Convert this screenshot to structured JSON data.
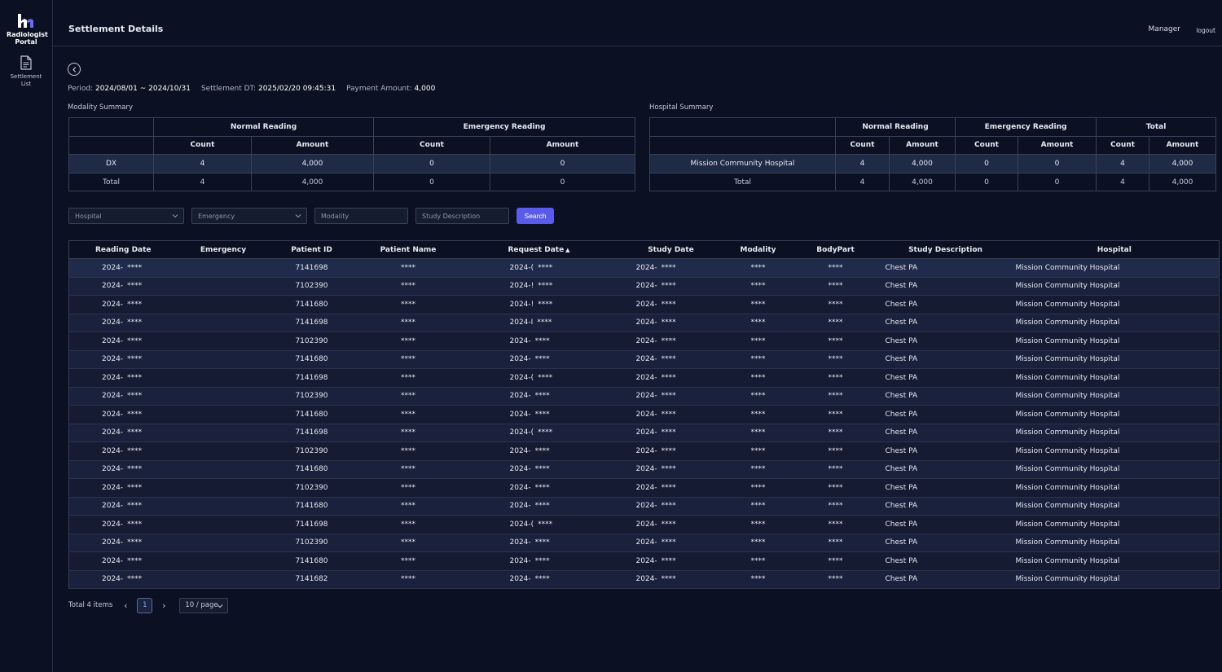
{
  "app": {
    "logo_text": "Radiologist Portal"
  },
  "sidebar": {
    "items": [
      {
        "label": "Settlement List",
        "icon": "document-icon"
      }
    ]
  },
  "header": {
    "title": "Settlement Details",
    "role": "Manager",
    "logout": "logout"
  },
  "info": {
    "period_label": "Period:",
    "period": "2024/08/01 ~ 2024/10/31",
    "settlement_dt_label": "Settlement DT:",
    "settlement_dt": "2025/02/20 09:45:31",
    "payment_label": "Payment Amount:",
    "payment": "4,000"
  },
  "modality_summary": {
    "label": "Modality Summary",
    "groups": [
      "Normal Reading",
      "Emergency Reading"
    ],
    "subcols": [
      "Count",
      "Amount",
      "Count",
      "Amount"
    ],
    "rows": [
      {
        "name": "DX",
        "values": [
          "4",
          "4,000",
          "0",
          "0"
        ]
      },
      {
        "name": "Total",
        "values": [
          "4",
          "4,000",
          "0",
          "0"
        ]
      }
    ]
  },
  "hospital_summary": {
    "label": "Hospital Summary",
    "groups": [
      "Normal Reading",
      "Emergency Reading",
      "Total"
    ],
    "subcols": [
      "Count",
      "Amount",
      "Count",
      "Amount",
      "Count",
      "Amount"
    ],
    "rows": [
      {
        "name": "Mission Community Hospital",
        "values": [
          "4",
          "4,000",
          "0",
          "0",
          "4",
          "4,000"
        ]
      },
      {
        "name": "Total",
        "values": [
          "4",
          "4,000",
          "0",
          "0",
          "4",
          "4,000"
        ]
      }
    ]
  },
  "filters": {
    "hospital_placeholder": "Hospital",
    "emergency_placeholder": "Emergency",
    "modality_placeholder": "Modality",
    "study_desc_placeholder": "Study Description",
    "search_label": "Search"
  },
  "table": {
    "columns": [
      "Reading Date",
      "Emergency",
      "Patient ID",
      "Patient Name",
      "Request Date",
      "Study Date",
      "Modality",
      "BodyPart",
      "Study Description",
      "Hospital"
    ],
    "sort_indicator": "▲",
    "rows": [
      {
        "reading_prefix": "2024-",
        "reading_mask": "****",
        "emergency": "",
        "patient_id": "7141698",
        "patient_name": "****",
        "request_prefix": "2024-(",
        "request_mask": "****",
        "study_prefix": "2024-",
        "study_mask": "****",
        "modality": "****",
        "bodypart": "****",
        "study_desc": "Chest PA",
        "hospital": "Mission Community Hospital"
      },
      {
        "reading_prefix": "2024-",
        "reading_mask": "****",
        "emergency": "",
        "patient_id": "7102390",
        "patient_name": "****",
        "request_prefix": "2024-!",
        "request_mask": "****",
        "study_prefix": "2024-",
        "study_mask": "****",
        "modality": "****",
        "bodypart": "****",
        "study_desc": "Chest PA",
        "hospital": "Mission Community Hospital"
      },
      {
        "reading_prefix": "2024-",
        "reading_mask": "****",
        "emergency": "",
        "patient_id": "7141680",
        "patient_name": "****",
        "request_prefix": "2024-!",
        "request_mask": "****",
        "study_prefix": "2024-",
        "study_mask": "****",
        "modality": "****",
        "bodypart": "****",
        "study_desc": "Chest PA",
        "hospital": "Mission Community Hospital"
      },
      {
        "reading_prefix": "2024-",
        "reading_mask": "****",
        "emergency": "",
        "patient_id": "7141698",
        "patient_name": "****",
        "request_prefix": "2024-I",
        "request_mask": "****",
        "study_prefix": "2024-",
        "study_mask": "****",
        "modality": "****",
        "bodypart": "****",
        "study_desc": "Chest PA",
        "hospital": "Mission Community Hospital"
      },
      {
        "reading_prefix": "2024-",
        "reading_mask": "****",
        "emergency": "",
        "patient_id": "7102390",
        "patient_name": "****",
        "request_prefix": "2024-",
        "request_mask": "****",
        "study_prefix": "2024-",
        "study_mask": "****",
        "modality": "****",
        "bodypart": "****",
        "study_desc": "Chest PA",
        "hospital": "Mission Community Hospital"
      },
      {
        "reading_prefix": "2024-",
        "reading_mask": "****",
        "emergency": "",
        "patient_id": "7141680",
        "patient_name": "****",
        "request_prefix": "2024-",
        "request_mask": "****",
        "study_prefix": "2024-",
        "study_mask": "****",
        "modality": "****",
        "bodypart": "****",
        "study_desc": "Chest PA",
        "hospital": "Mission Community Hospital"
      },
      {
        "reading_prefix": "2024-",
        "reading_mask": "****",
        "emergency": "",
        "patient_id": "7141698",
        "patient_name": "****",
        "request_prefix": "2024-(",
        "request_mask": "****",
        "study_prefix": "2024-",
        "study_mask": "****",
        "modality": "****",
        "bodypart": "****",
        "study_desc": "Chest PA",
        "hospital": "Mission Community Hospital"
      },
      {
        "reading_prefix": "2024-",
        "reading_mask": "****",
        "emergency": "",
        "patient_id": "7102390",
        "patient_name": "****",
        "request_prefix": "2024-",
        "request_mask": "****",
        "study_prefix": "2024-",
        "study_mask": "****",
        "modality": "****",
        "bodypart": "****",
        "study_desc": "Chest PA",
        "hospital": "Mission Community Hospital"
      },
      {
        "reading_prefix": "2024-",
        "reading_mask": "****",
        "emergency": "",
        "patient_id": "7141680",
        "patient_name": "****",
        "request_prefix": "2024-",
        "request_mask": "****",
        "study_prefix": "2024-",
        "study_mask": "****",
        "modality": "****",
        "bodypart": "****",
        "study_desc": "Chest PA",
        "hospital": "Mission Community Hospital"
      },
      {
        "reading_prefix": "2024-",
        "reading_mask": "****",
        "emergency": "",
        "patient_id": "7141698",
        "patient_name": "****",
        "request_prefix": "2024-(",
        "request_mask": "****",
        "study_prefix": "2024-",
        "study_mask": "****",
        "modality": "****",
        "bodypart": "****",
        "study_desc": "Chest PA",
        "hospital": "Mission Community Hospital"
      },
      {
        "reading_prefix": "2024-",
        "reading_mask": "****",
        "emergency": "",
        "patient_id": "7102390",
        "patient_name": "****",
        "request_prefix": "2024-",
        "request_mask": "****",
        "study_prefix": "2024-",
        "study_mask": "****",
        "modality": "****",
        "bodypart": "****",
        "study_desc": "Chest PA",
        "hospital": "Mission Community Hospital"
      },
      {
        "reading_prefix": "2024-",
        "reading_mask": "****",
        "emergency": "",
        "patient_id": "7141680",
        "patient_name": "****",
        "request_prefix": "2024-",
        "request_mask": "****",
        "study_prefix": "2024-",
        "study_mask": "****",
        "modality": "****",
        "bodypart": "****",
        "study_desc": "Chest PA",
        "hospital": "Mission Community Hospital"
      },
      {
        "reading_prefix": "2024-",
        "reading_mask": "****",
        "emergency": "",
        "patient_id": "7102390",
        "patient_name": "****",
        "request_prefix": "2024-",
        "request_mask": "****",
        "study_prefix": "2024-",
        "study_mask": "****",
        "modality": "****",
        "bodypart": "****",
        "study_desc": "Chest PA",
        "hospital": "Mission Community Hospital"
      },
      {
        "reading_prefix": "2024-",
        "reading_mask": "****",
        "emergency": "",
        "patient_id": "7141680",
        "patient_name": "****",
        "request_prefix": "2024-",
        "request_mask": "****",
        "study_prefix": "2024-",
        "study_mask": "****",
        "modality": "****",
        "bodypart": "****",
        "study_desc": "Chest PA",
        "hospital": "Mission Community Hospital"
      },
      {
        "reading_prefix": "2024-",
        "reading_mask": "****",
        "emergency": "",
        "patient_id": "7141698",
        "patient_name": "****",
        "request_prefix": "2024-(",
        "request_mask": "****",
        "study_prefix": "2024-",
        "study_mask": "****",
        "modality": "****",
        "bodypart": "****",
        "study_desc": "Chest PA",
        "hospital": "Mission Community Hospital"
      },
      {
        "reading_prefix": "2024-",
        "reading_mask": "****",
        "emergency": "",
        "patient_id": "7102390",
        "patient_name": "****",
        "request_prefix": "2024-",
        "request_mask": "****",
        "study_prefix": "2024-",
        "study_mask": "****",
        "modality": "****",
        "bodypart": "****",
        "study_desc": "Chest PA",
        "hospital": "Mission Community Hospital"
      },
      {
        "reading_prefix": "2024-",
        "reading_mask": "****",
        "emergency": "",
        "patient_id": "7141680",
        "patient_name": "****",
        "request_prefix": "2024-",
        "request_mask": "****",
        "study_prefix": "2024-",
        "study_mask": "****",
        "modality": "****",
        "bodypart": "****",
        "study_desc": "Chest PA",
        "hospital": "Mission Community Hospital"
      },
      {
        "reading_prefix": "2024-",
        "reading_mask": "****",
        "emergency": "",
        "patient_id": "7141682",
        "patient_name": "****",
        "request_prefix": "2024-",
        "request_mask": "****",
        "study_prefix": "2024-",
        "study_mask": "****",
        "modality": "****",
        "bodypart": "****",
        "study_desc": "Chest PA",
        "hospital": "Mission Community Hospital"
      }
    ]
  },
  "pagination": {
    "total_text": "Total 4 items",
    "current_page": "1",
    "page_size": "10 / page"
  },
  "colors": {
    "background": "#0b1122",
    "accent": "#5a5bea",
    "selected_row": "#202a4a"
  }
}
